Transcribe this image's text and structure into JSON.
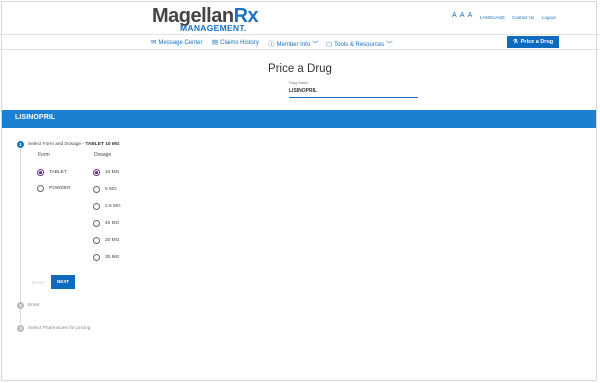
{
  "header": {
    "logo_line1_a": "Magellan",
    "logo_line1_b": "Rx",
    "logo_line2": "MANAGEMENT.",
    "text_size": "A A A",
    "language": "LANGUAGE",
    "contact": "Contact Us",
    "logout": "Logout"
  },
  "nav": {
    "items": [
      {
        "icon": "envelope-icon",
        "label": "Message Center"
      },
      {
        "icon": "calendar-icon",
        "label": "Claims History"
      },
      {
        "icon": "info-icon",
        "label": "Member Info"
      },
      {
        "icon": "folder-icon",
        "label": "Tools & Resources"
      }
    ],
    "price_button": "Price a Drug"
  },
  "page": {
    "title": "Price a Drug",
    "drug_name_label": "Drug Name",
    "drug_name_value": "LISINOPRIL",
    "banner": "LISINOPRIL"
  },
  "stepper": {
    "steps": [
      {
        "number": "1",
        "label": "Select Form and Dosage - ",
        "selection": "TABLET 10 MG"
      },
      {
        "number": "2",
        "label": "Enter"
      },
      {
        "number": "3",
        "label": "Select Pharmacies for pricing"
      }
    ],
    "form_header": "Form",
    "dosage_header": "Dosage",
    "forms": [
      {
        "label": "TABLET",
        "selected": true
      },
      {
        "label": "POWDER",
        "selected": false
      }
    ],
    "dosages": [
      {
        "label": "10 MG",
        "selected": true
      },
      {
        "label": "5 MG",
        "selected": false
      },
      {
        "label": "2.5 MG",
        "selected": false
      },
      {
        "label": "40 MG",
        "selected": false
      },
      {
        "label": "20 MG",
        "selected": false
      },
      {
        "label": "30 MG",
        "selected": false
      }
    ],
    "back_label": "BACK",
    "next_label": "NEXT"
  },
  "colors": {
    "brand_blue": "#1b7fd2",
    "button_blue": "#0f6bbf",
    "radio_selected": "#6b2f8c"
  }
}
